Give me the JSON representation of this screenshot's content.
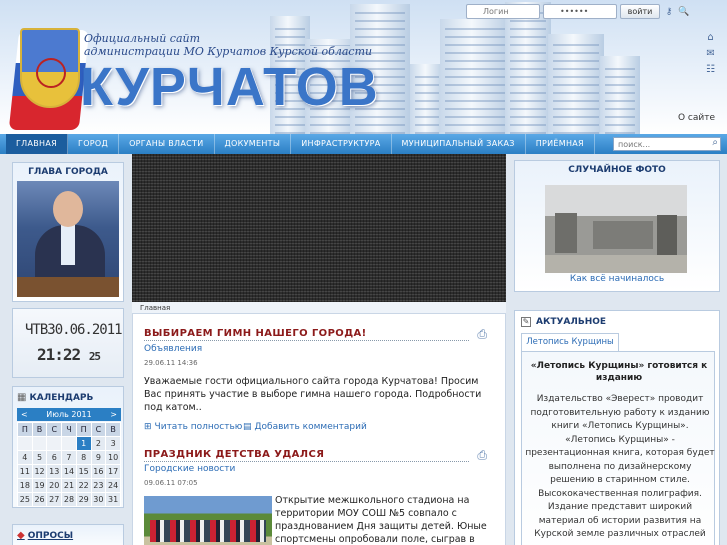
{
  "header": {
    "site_title_line1": "Официальный сайт",
    "site_title_line2": "администрации МО Курчатов Курской области",
    "city_logo": "КУРЧАТОВ",
    "login_placeholder": "Логин",
    "password_value": "••••••",
    "login_button": "войти",
    "about_link": "О сайте"
  },
  "nav": {
    "items": [
      "ГЛАВНАЯ",
      "ГОРОД",
      "ОРГАНЫ ВЛАСТИ",
      "ДОКУМЕНТЫ",
      "ИНФРАСТРУКТУРА",
      "МУНИЦИПАЛЬНЫЙ ЗАКАЗ",
      "ПРИЁМНАЯ"
    ],
    "active": "ГЛАВНАЯ",
    "search_placeholder": "поиск..."
  },
  "left": {
    "mayor_title": "ГЛАВА ГОРОДА",
    "clock_date": "ЧТВ30.06.2011",
    "clock_time": "21:22",
    "clock_seconds": "25",
    "calendar_title": "КАЛЕНДАРЬ",
    "calendar_month": "Июль 2011",
    "calendar_prev": "<",
    "calendar_next": ">",
    "calendar_weekdays": [
      "П",
      "В",
      "С",
      "Ч",
      "П",
      "С",
      "В"
    ],
    "calendar_weeks": [
      [
        "",
        "",
        "",
        "",
        "1",
        "2",
        "3"
      ],
      [
        "4",
        "5",
        "6",
        "7",
        "8",
        "9",
        "10"
      ],
      [
        "11",
        "12",
        "13",
        "14",
        "15",
        "16",
        "17"
      ],
      [
        "18",
        "19",
        "20",
        "21",
        "22",
        "23",
        "24"
      ],
      [
        "25",
        "26",
        "27",
        "28",
        "29",
        "30",
        "31"
      ]
    ],
    "calendar_today": "1",
    "polls_title": "ОПРОСЫ"
  },
  "main": {
    "breadcrumb": "Главная",
    "article1": {
      "title": "ВЫБИРАЕМ ГИМН НАШЕГО ГОРОДА!",
      "category": "Объявления",
      "date": "29.06.11 14:36",
      "text": "Уважаемые гости официального сайта города Курчатова! Просим Вас принять участие в выборе гимна нашего города. Подробности под катом..",
      "read_more": "Читать полностью",
      "add_comment": "Добавить комментарий"
    },
    "article2": {
      "title": "ПРАЗДНИК ДЕТСТВА УДАЛСЯ",
      "category": "Городские новости",
      "date": "09.06.11 07:05",
      "text": "Открытие межшкольного стадиона на территории МОУ СОШ №5 совпало с празднованием Дня защиты детей. Юные спортсмены опробовали поле, сыграв в"
    }
  },
  "right": {
    "photo_title": "СЛУЧАЙНОЕ ФОТО",
    "photo_caption": "Как всё начиналось",
    "actual_title": "АКТУАЛЬНОЕ",
    "actual_tab": "Летопись Курщины",
    "actual_heading": "«Летопись Курщины» готовится к изданию",
    "actual_text": "Издательство «Эверест» проводит подготовительную работу к изданию книги «Летопись Курщины». «Летопись Курщины» - презентационная книга, которая будет выполнена по дизайнерскому решению в старинном стиле. Высококачественная полиграфия. Издание представит широкий материал об истории развития на Курской земле различных отраслей промышленности и торговли, отражает"
  }
}
